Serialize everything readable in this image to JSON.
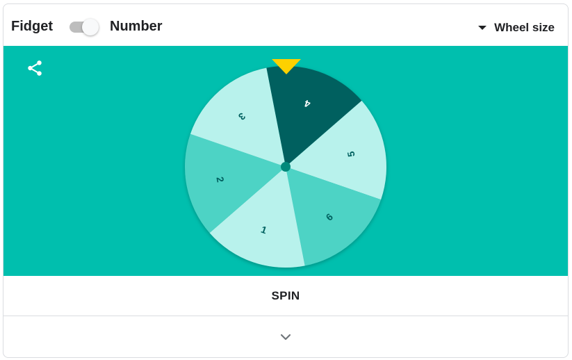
{
  "mode_toggle": {
    "left_label": "Fidget",
    "right_label": "Number",
    "state": "on"
  },
  "wheel_size": {
    "label": "Wheel size",
    "icon": "caret-down-icon"
  },
  "share": {
    "icon": "share-icon"
  },
  "wheel": {
    "pointer_color": "#fdd100",
    "segments": [
      {
        "label": "4",
        "color": "#00605f",
        "text_color": "#ffffff"
      },
      {
        "label": "5",
        "color": "#b8f2ec",
        "text_color": "#00605f"
      },
      {
        "label": "6",
        "color": "#4dd3c5",
        "text_color": "#00605f"
      },
      {
        "label": "1",
        "color": "#b8f2ec",
        "text_color": "#00605f"
      },
      {
        "label": "2",
        "color": "#4dd3c5",
        "text_color": "#00605f"
      },
      {
        "label": "3",
        "color": "#b8f2ec",
        "text_color": "#00605f"
      }
    ]
  },
  "spin": {
    "label": "SPIN"
  },
  "expand": {
    "icon": "chevron-down-icon"
  },
  "colors": {
    "stage_background": "#00bfae",
    "hub": "#00897b"
  }
}
